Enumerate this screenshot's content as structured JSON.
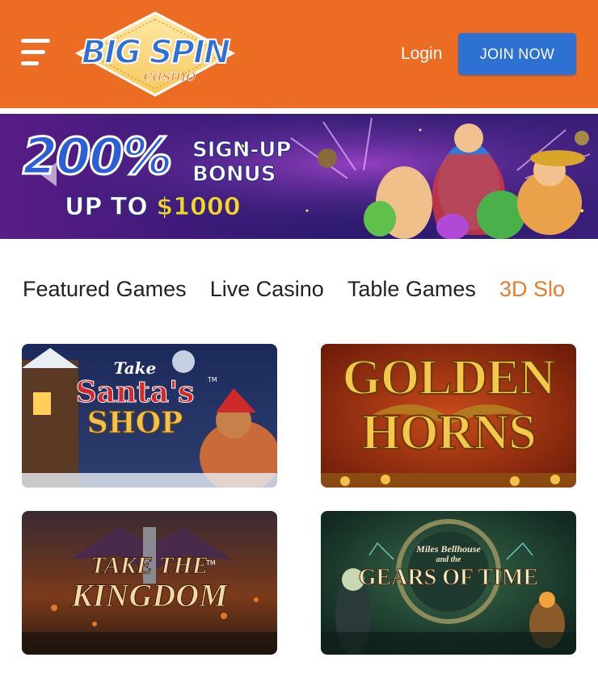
{
  "header": {
    "logo_text": "BIG SPIN",
    "logo_sub": "casino",
    "login_label": "Login",
    "join_label": "JOIN NOW",
    "brand_color": "#ec6c24",
    "join_color": "#2d72d2"
  },
  "banner": {
    "percent": "200%",
    "signup_line1": "SIGN-UP",
    "signup_line2": "BONUS",
    "upto": "UP TO",
    "amount": "$1000"
  },
  "tabs": [
    {
      "label": "Featured Games",
      "active": false
    },
    {
      "label": "Live Casino",
      "active": false
    },
    {
      "label": "Table Games",
      "active": false
    },
    {
      "label": "3D Slo",
      "active": true
    }
  ],
  "games": [
    {
      "title_top": "Take",
      "title_main": "Santa's",
      "title_bottom": "SHOP",
      "tm": "TM"
    },
    {
      "title_top": "GOLDEN",
      "title_bottom": "HORNS"
    },
    {
      "title_top": "TAKE THE",
      "title_bottom": "KINGDOM",
      "tm": "TM"
    },
    {
      "title_top": "Miles Bellhouse",
      "title_mid": "and the",
      "title_bottom": "GEARS OF TIME"
    }
  ]
}
